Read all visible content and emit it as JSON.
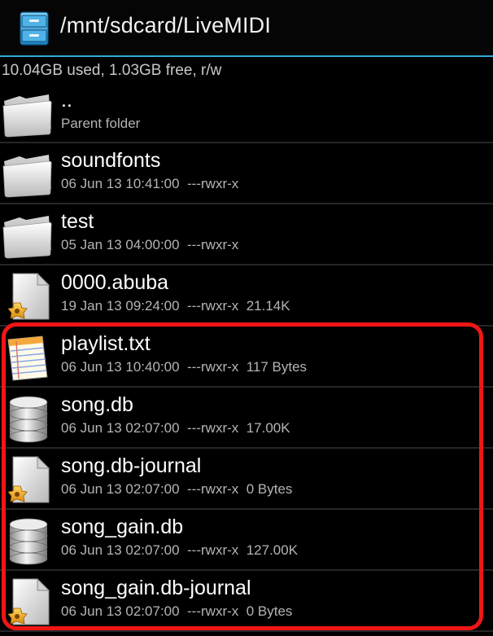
{
  "header": {
    "path": "/mnt/sdcard/LiveMIDI",
    "app_icon": "file-manager-drawer-icon"
  },
  "status": {
    "text": "10.04GB used, 1.03GB free, r/w"
  },
  "files": [
    {
      "name": "..",
      "info": "Parent folder",
      "icon": "folder-icon"
    },
    {
      "name": "soundfonts",
      "info": "06 Jun 13 10:41:00  ---rwxr-x",
      "icon": "folder-icon"
    },
    {
      "name": "test",
      "info": "05 Jan 13 04:00:00  ---rwxr-x",
      "icon": "folder-icon"
    },
    {
      "name": "0000.abuba",
      "info": "19 Jan 13 09:24:00  ---rwxr-x  21.14K",
      "icon": "unknown-file-icon"
    },
    {
      "name": "playlist.txt",
      "info": "06 Jun 13 10:40:00  ---rwxr-x  117 Bytes",
      "icon": "text-file-icon"
    },
    {
      "name": "song.db",
      "info": "06 Jun 13 02:07:00  ---rwxr-x  17.00K",
      "icon": "database-icon"
    },
    {
      "name": "song.db-journal",
      "info": "06 Jun 13 02:07:00  ---rwxr-x  0 Bytes",
      "icon": "unknown-file-icon"
    },
    {
      "name": "song_gain.db",
      "info": "06 Jun 13 02:07:00  ---rwxr-x  127.00K",
      "icon": "database-icon"
    },
    {
      "name": "song_gain.db-journal",
      "info": "06 Jun 13 02:07:00  ---rwxr-x  0 Bytes",
      "icon": "unknown-file-icon"
    }
  ],
  "colors": {
    "accent": "#33a9d6",
    "highlight": "#f01616"
  }
}
